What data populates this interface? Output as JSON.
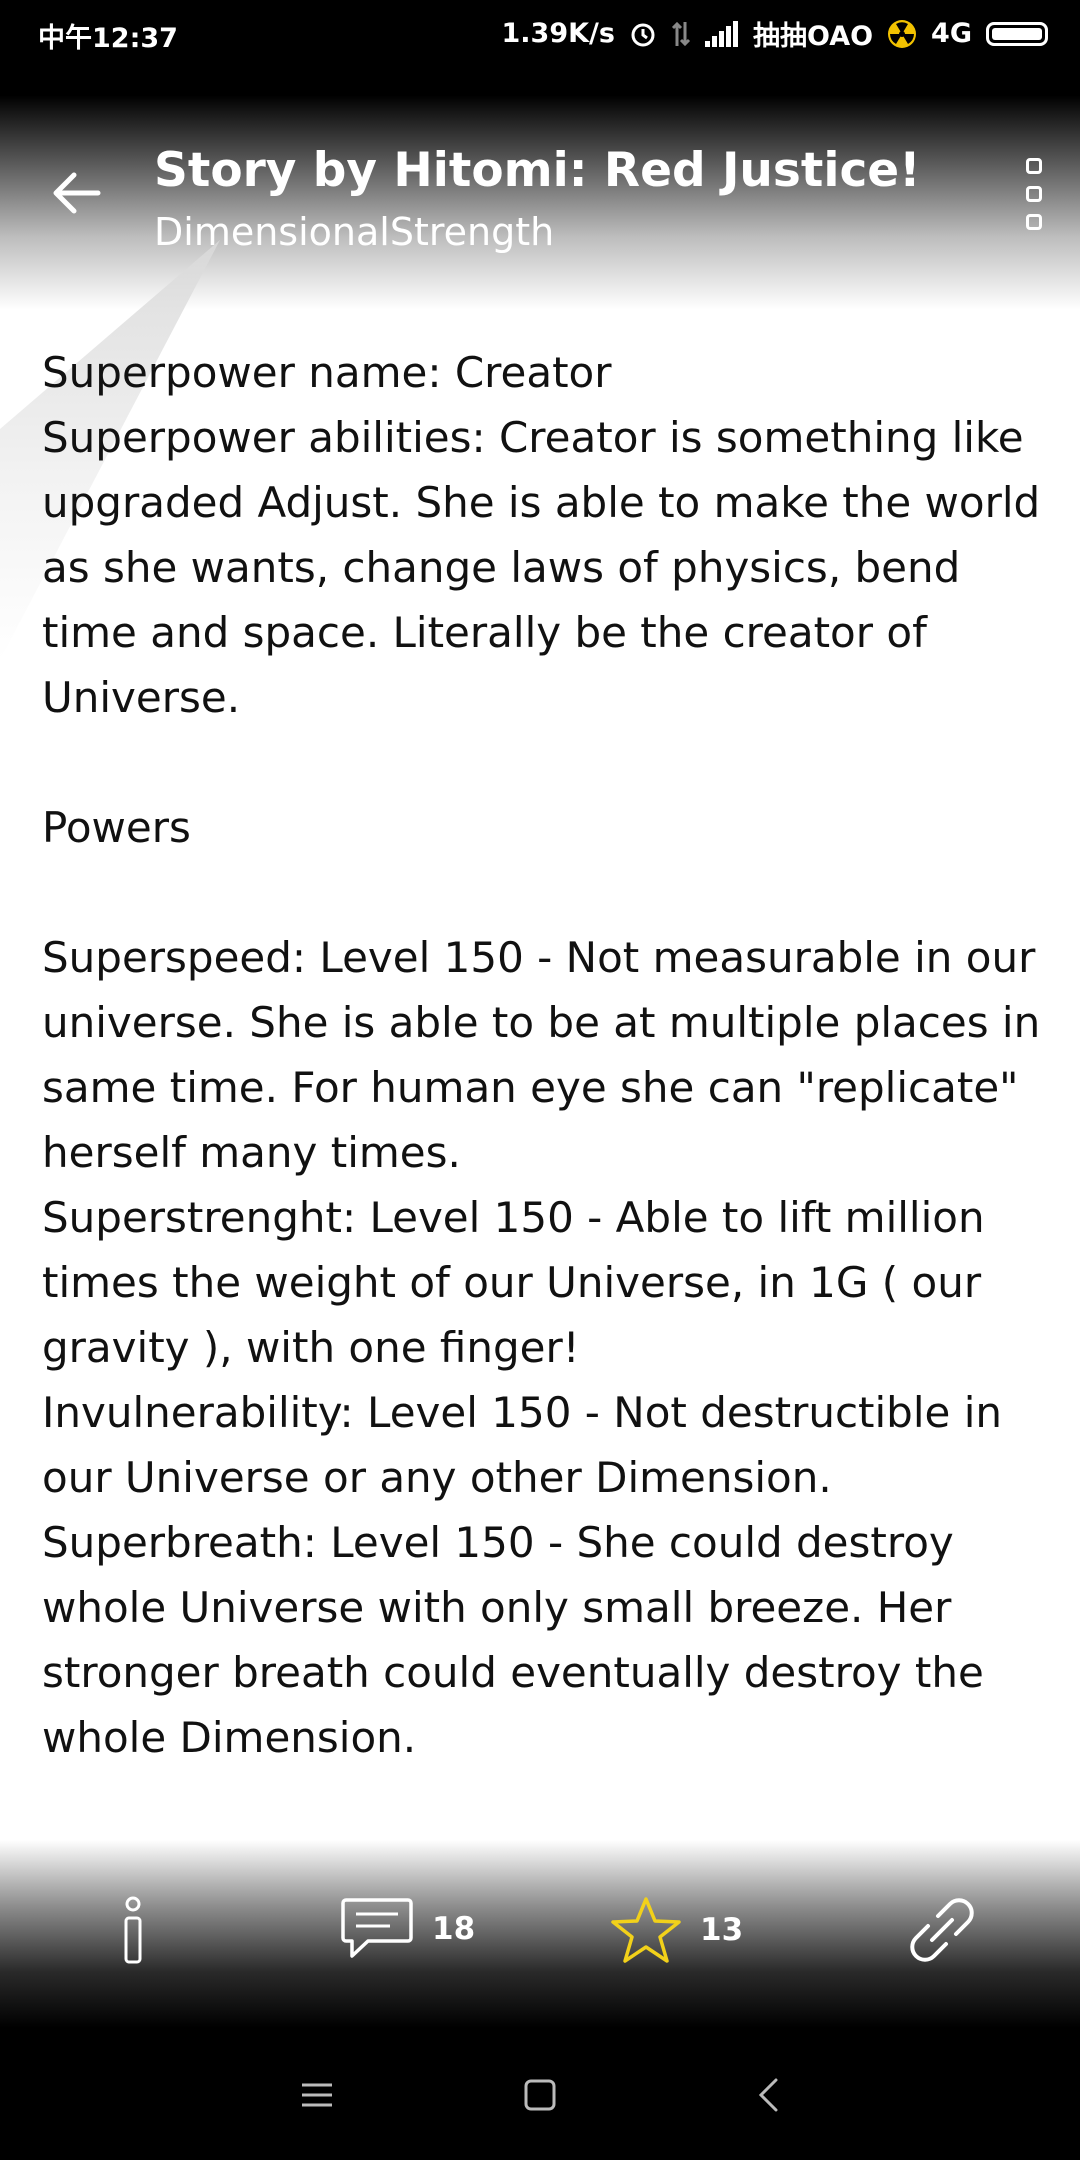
{
  "status_bar": {
    "time": "中午12:37",
    "net_speed": "1.39K/s",
    "carrier": "抽抽OAO",
    "network": "4G"
  },
  "header": {
    "title": "Story by Hitomi: Red Justice!",
    "subtitle": "DimensionalStrength"
  },
  "content": {
    "superpower_name": "Superpower name: Creator",
    "superpower_abilities": "Superpower abilities: Creator is something like upgraded Adjust. She is able to make the world as she wants, change laws of physics, bend time and space. Literally be the creator of Universe.",
    "powers_heading": "Powers",
    "superspeed": "Superspeed: Level 150 - Not measurable in our universe. She is able to be at multiple places in same time. For human eye she can \"replicate\" herself many times.",
    "superstrength": "Superstrenght: Level 150 - Able to lift million times the weight of our Universe, in 1G ( our gravity ), with one finger!",
    "invulnerability": "Invulnerability: Level 150 - Not destructible in our Universe or any other Dimension.",
    "superbreath": "Superbreath: Level 150 - She could destroy whole Universe with only small breeze. Her stronger breath could eventually destroy the whole Dimension."
  },
  "actions": {
    "comments_count": "18",
    "stars_count": "13"
  },
  "icons": {
    "back": "arrow-left-icon",
    "menu": "more-vertical-icon",
    "info": "info-icon",
    "comments": "comment-icon",
    "star": "star-icon",
    "link": "link-icon",
    "nav_recents": "menu-icon",
    "nav_home": "square-icon",
    "nav_back": "chevron-left-icon"
  },
  "colors": {
    "star": "#f2d11a",
    "text": "#111111"
  }
}
